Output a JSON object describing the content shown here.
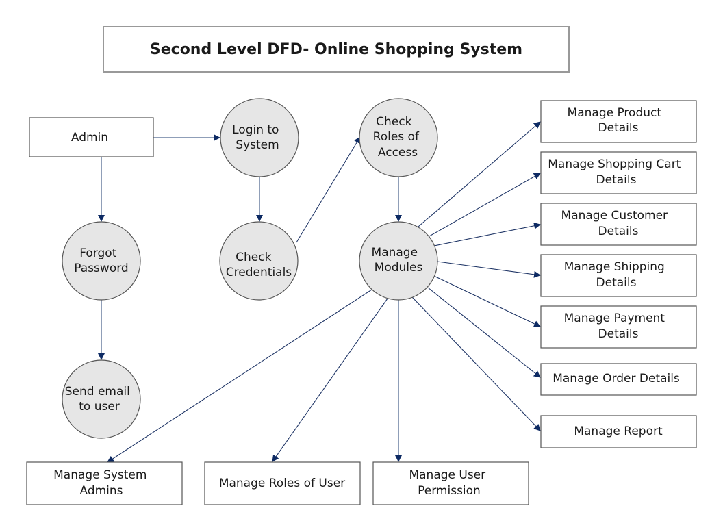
{
  "title": "Second Level DFD- Online Shopping System",
  "colors": {
    "arrow": "#0d2a63",
    "process_fill": "#e6e6e6",
    "entity_fill": "#ffffff",
    "stroke": "#555555"
  },
  "entities": {
    "admin": "Admin"
  },
  "processes": {
    "login": [
      "Login to",
      "System"
    ],
    "check_credentials": [
      "Check",
      "Credentials"
    ],
    "forgot_password": [
      "Forgot",
      "Password"
    ],
    "send_email": [
      "Send email",
      "to user"
    ],
    "check_roles": [
      "Check",
      "Roles of",
      "Access"
    ],
    "manage_modules": [
      "Manage",
      "Modules"
    ]
  },
  "modules_right": [
    [
      "Manage Product",
      "Details"
    ],
    [
      "Manage Shopping Cart",
      "Details"
    ],
    [
      "Manage Customer",
      "Details"
    ],
    [
      "Manage Shipping",
      "Details"
    ],
    [
      "Manage Payment",
      "Details"
    ],
    [
      "Manage Order Details"
    ],
    [
      "Manage Report"
    ]
  ],
  "modules_bottom": [
    [
      "Manage System",
      "Admins"
    ],
    [
      "Manage Roles of User"
    ],
    [
      "Manage User",
      "Permission"
    ]
  ],
  "flows": [
    {
      "from": "Admin",
      "to": "Login to System"
    },
    {
      "from": "Admin",
      "to": "Forgot Password"
    },
    {
      "from": "Forgot Password",
      "to": "Send email to user"
    },
    {
      "from": "Login to System",
      "to": "Check Credentials"
    },
    {
      "from": "Check Credentials",
      "to": "Check Roles of Access"
    },
    {
      "from": "Check Roles of Access",
      "to": "Manage Modules"
    },
    {
      "from": "Manage Modules",
      "to": "Manage Product Details"
    },
    {
      "from": "Manage Modules",
      "to": "Manage Shopping Cart Details"
    },
    {
      "from": "Manage Modules",
      "to": "Manage Customer Details"
    },
    {
      "from": "Manage Modules",
      "to": "Manage Shipping Details"
    },
    {
      "from": "Manage Modules",
      "to": "Manage Payment Details"
    },
    {
      "from": "Manage Modules",
      "to": "Manage Order Details"
    },
    {
      "from": "Manage Modules",
      "to": "Manage Report"
    },
    {
      "from": "Manage Modules",
      "to": "Manage System Admins"
    },
    {
      "from": "Manage Modules",
      "to": "Manage Roles of User"
    },
    {
      "from": "Manage Modules",
      "to": "Manage User Permission"
    }
  ]
}
